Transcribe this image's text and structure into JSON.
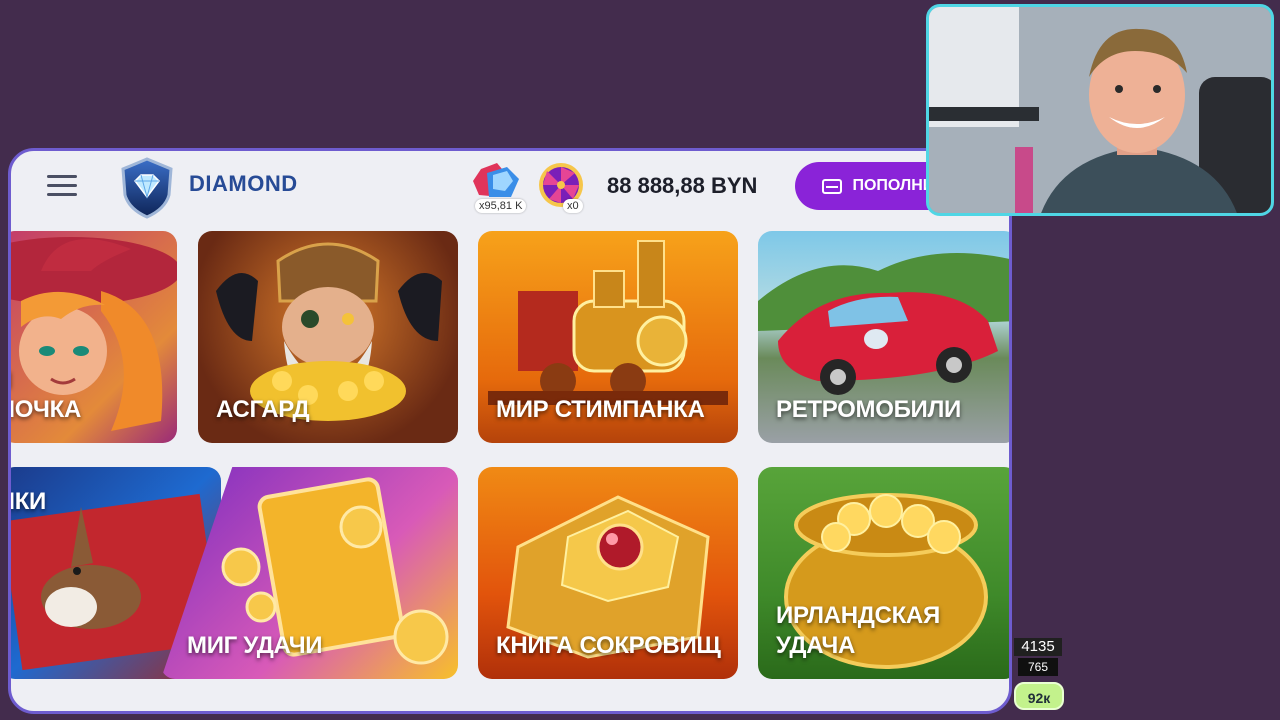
{
  "header": {
    "brand": "DIAMOND",
    "gem_badge": "x95,81 K",
    "wheel_badge": "x0",
    "balance": "88 888,88 BYN",
    "topup_label": "ПОПОЛНИТЬ"
  },
  "games": [
    {
      "label": "Я\nМОЧКА",
      "art": "witch-character"
    },
    {
      "label": "АСГАРД",
      "art": "viking-warrior-with-ravens"
    },
    {
      "label": "МИР СТИМПАНКА",
      "art": "golden-steam-locomotive"
    },
    {
      "label": "РЕТРОМОБИЛИ",
      "art": "red-retro-car"
    },
    {
      "label": "МКИ",
      "art": "hare-on-carpet"
    },
    {
      "label": "МИГ УДАЧИ",
      "art": "golden-ticket-and-coins"
    },
    {
      "label": "КНИГА СОКРОВИЩ",
      "art": "golden-treasure-book"
    },
    {
      "label": "ИРЛАНДСКАЯ УДАЧА",
      "art": "pot-of-gold"
    }
  ],
  "stream_stats": {
    "count_top": "4135",
    "count_mid": "765",
    "count_badge": "92к"
  },
  "colors": {
    "background": "#432c4d",
    "app_border": "#6e5ccf",
    "topup_button": "#8a23d8",
    "brand_text": "#274b96",
    "webcam_border": "#4fd6e5",
    "stat_badge": "#c3f28c"
  }
}
